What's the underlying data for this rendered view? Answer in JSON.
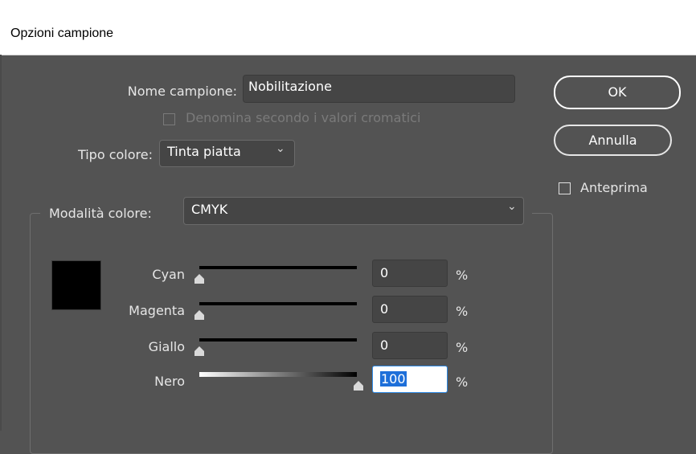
{
  "window": {
    "title": "Opzioni campione"
  },
  "name_row": {
    "label": "Nome campione:",
    "value": "Nobilitazione"
  },
  "name_by_color": {
    "label": "Denomina secondo i valori cromatici",
    "checked": false,
    "enabled": false
  },
  "color_type": {
    "label": "Tipo colore:",
    "value": "Tinta piatta"
  },
  "color_mode": {
    "label": "Modalità colore:",
    "value": "CMYK"
  },
  "swatch_color": "#000000",
  "channels": [
    {
      "label": "Cyan",
      "value": "0",
      "unit": "%"
    },
    {
      "label": "Magenta",
      "value": "0",
      "unit": "%"
    },
    {
      "label": "Giallo",
      "value": "0",
      "unit": "%"
    },
    {
      "label": "Nero",
      "value": "100",
      "unit": "%"
    }
  ],
  "buttons": {
    "ok": "OK",
    "cancel": "Annulla"
  },
  "preview": {
    "label": "Anteprima",
    "checked": false
  },
  "icons": {
    "dropdown": "chevron-down-icon",
    "slider_thumb": "triangle-thumb-icon"
  }
}
